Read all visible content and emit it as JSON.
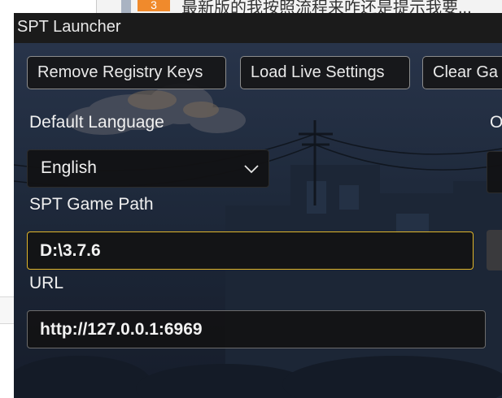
{
  "background": {
    "top_badge": "3",
    "top_text": "最新版的我按照流程来咋还是提示我要..."
  },
  "window": {
    "title": "SPT Launcher"
  },
  "buttons": {
    "remove_registry": "Remove Registry Keys",
    "load_live": "Load Live Settings",
    "clear": "Clear Ga"
  },
  "form": {
    "language_label": "Default Language",
    "language_value": "English",
    "other_label_partial": "O",
    "game_path_label": "SPT Game Path",
    "game_path_value": "D:\\3.7.6",
    "url_label": "URL",
    "url_value": "http://127.0.0.1:6969"
  },
  "icons": {
    "dropdown": "chevron-down-icon"
  },
  "colors": {
    "focus_border": "#e0b52a",
    "panel": "#121214",
    "titlebar": "#1b1b1b"
  }
}
